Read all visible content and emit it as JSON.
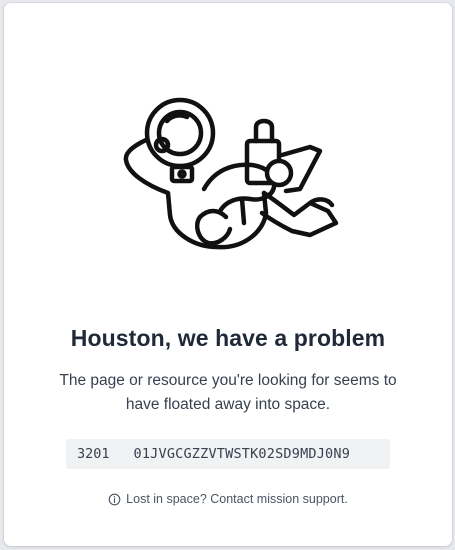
{
  "error": {
    "title": "Houston, we have a problem",
    "message": "The page or resource you're looking for seems to have floated away into space.",
    "status_code": "3201",
    "request_id": "01JVGCGZZVTWSTK02SD9MDJ0N9",
    "support_text": "Lost in space? Contact mission support."
  },
  "icons": {
    "illustration": "floating-astronaut-icon",
    "support": "info-circle-icon"
  }
}
